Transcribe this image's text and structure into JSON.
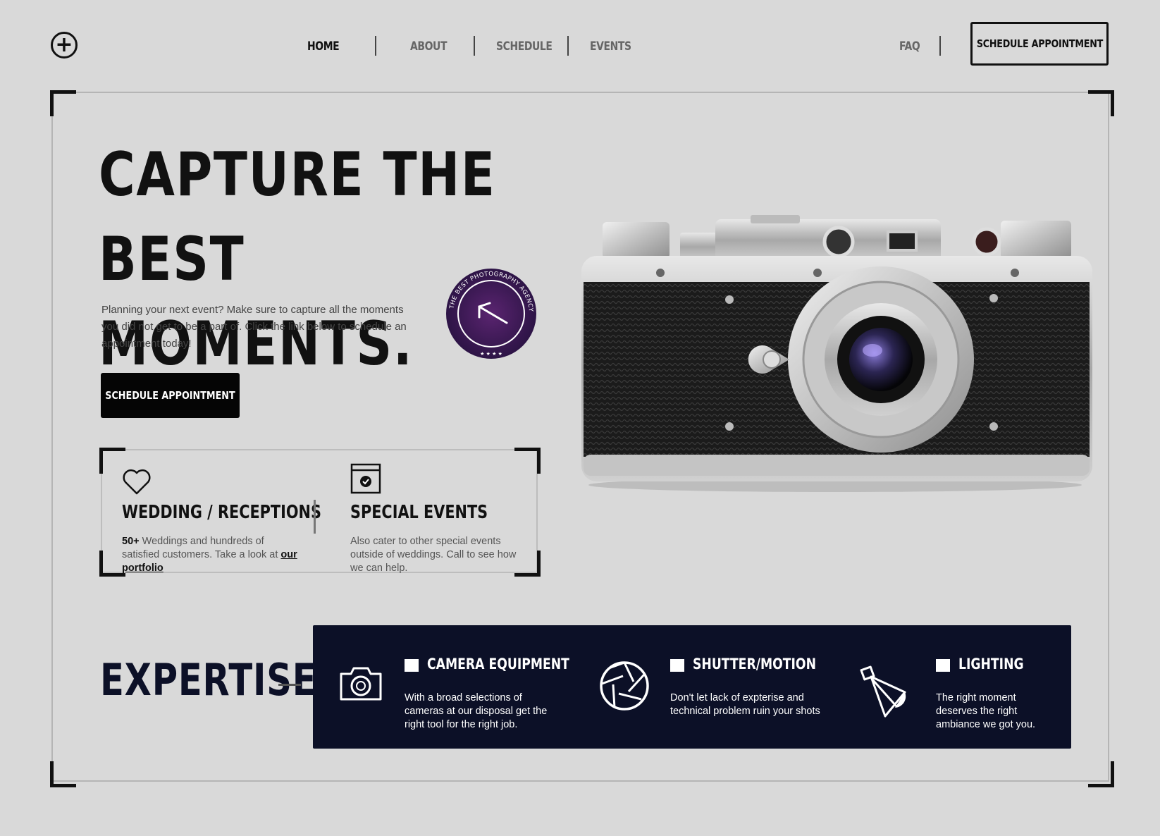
{
  "nav": {
    "logo_icon": "plus-circle-icon",
    "links": [
      {
        "label": "HOME",
        "active": true
      },
      {
        "label": "ABOUT",
        "active": false
      },
      {
        "label": "SCHEDULE",
        "active": false
      },
      {
        "label": "EVENTS",
        "active": false
      }
    ],
    "faq": "FAQ",
    "cta": "SCHEDULE APPOINTMENT"
  },
  "hero": {
    "title_line1": "CAPTURE THE BEST",
    "title_line2": "MOMENTS.",
    "description": "Planning your next event? Make sure to capture all the moments you did not get to be a part of.  Click the link below to schedule an appointment today!",
    "cta": "SCHEDULE APPOINTMENT",
    "badge_text": "THE BEST PHOTOGRAPHY AGENCY",
    "badge_icon": "arrow-up-left-icon"
  },
  "services": [
    {
      "icon": "heart-icon",
      "title": "WEDDING / RECEPTIONS",
      "count": "50+",
      "text": "Weddings and hundreds of satisfied customers. Take a look at",
      "link": "our portfolio"
    },
    {
      "icon": "calendar-check-icon",
      "title": "SPECIAL EVENTS",
      "text": "Also cater to other special events outside of weddings. Call to see how we can help."
    }
  ],
  "expertise": {
    "title": "EXPERTISE",
    "items": [
      {
        "icon": "camera-icon",
        "heading": "CAMERA EQUIPMENT",
        "text": " With a broad selections of cameras at our disposal get the right tool for the right job."
      },
      {
        "icon": "aperture-icon",
        "heading": "SHUTTER/MOTION",
        "text": "Don't let lack of expterise and technical problem ruin your shots"
      },
      {
        "icon": "lamp-icon",
        "heading": "LIGHTING",
        "text": "The right moment deserves the right ambiance we got you."
      }
    ]
  },
  "colors": {
    "background": "#d9d9d9",
    "navy": "#0c1027",
    "badge": "#3b1a52",
    "black": "#050505"
  }
}
